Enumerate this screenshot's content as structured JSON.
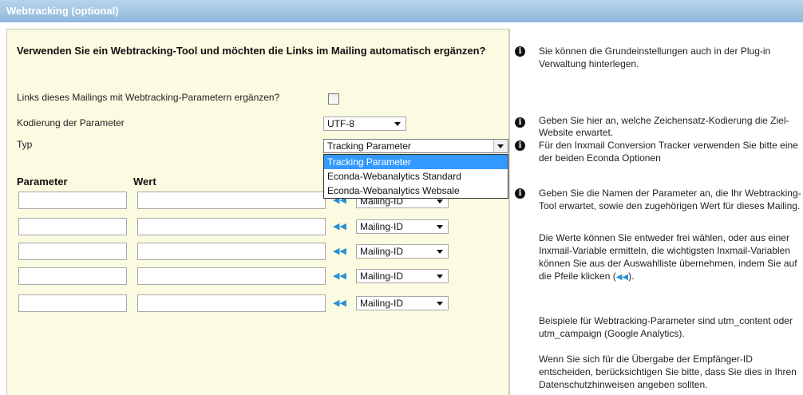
{
  "section": {
    "title": "Webtracking (optional)"
  },
  "form": {
    "question": "Verwenden Sie ein Webtracking-Tool und möchten die Links im Mailing automatisch ergänzen?",
    "checkbox_label": "Links dieses Mailings mit Webtracking-Parametern ergänzen?",
    "checkbox_checked": false,
    "encoding_label": "Kodierung der Parameter",
    "encoding_value": "UTF-8",
    "type_label": "Typ",
    "type_value": "Tracking Parameter",
    "type_options": [
      "Tracking Parameter",
      "Econda-Webanalytics Standard",
      "Econda-Webanalytics Websale"
    ],
    "parameter_header": "Parameter",
    "value_header": "Wert",
    "rows": [
      {
        "parameter": "",
        "value": "",
        "variable": "Mailing-ID"
      },
      {
        "parameter": "",
        "value": "",
        "variable": "Mailing-ID"
      },
      {
        "parameter": "",
        "value": "",
        "variable": "Mailing-ID"
      },
      {
        "parameter": "",
        "value": "",
        "variable": "Mailing-ID"
      },
      {
        "parameter": "",
        "value": "",
        "variable": "Mailing-ID"
      }
    ]
  },
  "help": {
    "icon": "info-icon",
    "tip1": "Sie können die Grundeinstellungen auch in der Plug-in Verwaltung hinterlegen.",
    "tip2": "Geben Sie hier an, welche Zeichensatz-Kodierung die Ziel-Website erwartet.",
    "tip3": "Für den Inxmail Conversion Tracker verwenden Sie bitte eine der beiden Econda Optionen",
    "tip4": "Geben Sie die Namen der Parameter an, die Ihr Webtracking-Tool erwartet, sowie den zugehörigen Wert für dieses Mailing.",
    "tip4_p2_a": "Die Werte können Sie entweder frei wählen, oder aus einer Inxmail-Variable ermitteln, die wichtigsten Inxmail-Variablen können Sie aus der Auswahlliste übernehmen, indem Sie auf die Pfeile klicken (",
    "tip4_p2_b": ").",
    "tip4_p3": "Beispiele für Webtracking-Parameter sind utm_content oder utm_campaign (Google Analytics).",
    "tip4_p4": "Wenn Sie sich für die Übergabe der Empfänger-ID entscheiden, berücksichtigen Sie bitte, dass Sie dies in Ihren Datenschutzhinweisen angeben sollten."
  },
  "colors": {
    "title_bar": "#8db7dc",
    "form_background": "#fbfbe1",
    "selection": "#3399ff",
    "arrow_icon": "#2a8fd6"
  }
}
